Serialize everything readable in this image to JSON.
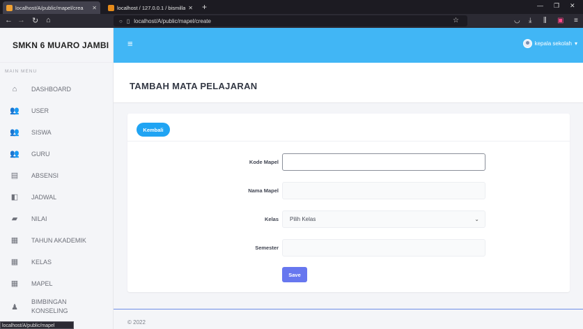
{
  "browser": {
    "tabs": [
      {
        "label": "localhost/A/public/mapel/crea"
      },
      {
        "label": "localhost / 127.0.0.1 / bismillah"
      }
    ],
    "new_tab": "+",
    "url": "localhost/A/public/mapel/create",
    "status_url": "localhost/A/public/mapel"
  },
  "sidebar": {
    "brand": "SMKN 6 MUARO JAMBI",
    "menu_header": "MAIN MENU",
    "items": [
      {
        "label": "DASHBOARD",
        "icon": "home-icon"
      },
      {
        "label": "USER",
        "icon": "users-icon"
      },
      {
        "label": "SISWA",
        "icon": "users-icon"
      },
      {
        "label": "GURU",
        "icon": "users-icon"
      },
      {
        "label": "ABSENSI",
        "icon": "clipboard-icon"
      },
      {
        "label": "JADWAL",
        "icon": "book-icon"
      },
      {
        "label": "NILAI",
        "icon": "flag-icon"
      },
      {
        "label": "TAHUN AKADEMIK",
        "icon": "calendar-icon"
      },
      {
        "label": "KELAS",
        "icon": "calendar-icon"
      },
      {
        "label": "MAPEL",
        "icon": "calendar-icon"
      },
      {
        "label": "BIMBINGAN KONSELING",
        "icon": "user-tie-icon"
      }
    ]
  },
  "header": {
    "user_name": "kepala sekolah"
  },
  "page": {
    "title": "TAMBAH MATA PELAJARAN",
    "back_label": "Kembali",
    "fields": {
      "kode_label": "Kode Mapel",
      "kode_value": "",
      "nama_label": "Nama Mapel",
      "nama_value": "",
      "kelas_label": "Kelas",
      "kelas_selected": "Pilih Kelas",
      "semester_label": "Semester",
      "semester_value": ""
    },
    "save_label": "Save"
  },
  "footer": {
    "text": "© 2022"
  },
  "colors": {
    "topbar": "#41b6f5",
    "back_button": "#20a4f3",
    "save_button": "#6777ef",
    "sidebar_bg": "#f4f5f8"
  }
}
